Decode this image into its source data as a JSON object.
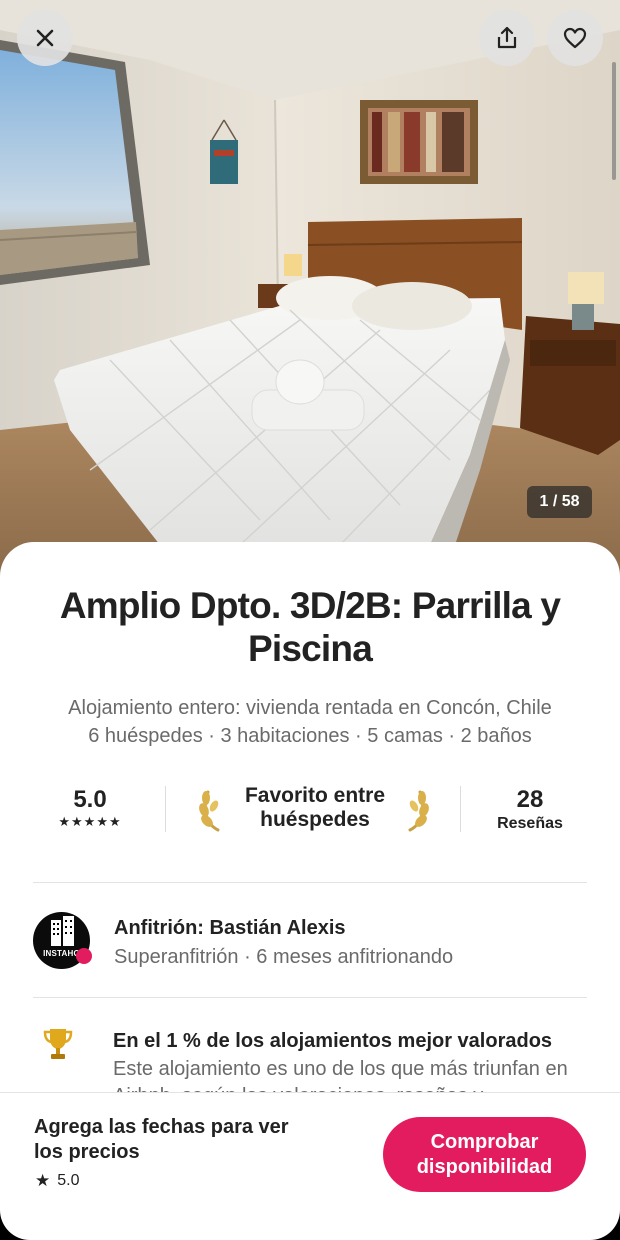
{
  "photo": {
    "counter": "1 / 58",
    "close_icon": "close-icon",
    "share_icon": "share-icon",
    "favorite_icon": "heart-icon"
  },
  "listing": {
    "title": "Amplio Dpto. 3D/2B: Parrilla y Piscina",
    "subtitle": "Alojamiento entero: vivienda rentada en Concón, Chile",
    "details": "6 huéspedes · 3 habitaciones · 5 camas · 2 baños"
  },
  "stats": {
    "rating": "5.0",
    "stars": "★★★★★",
    "guest_favorite": "Favorito entre huéspedes",
    "reviews_count": "28",
    "reviews_label": "Reseñas"
  },
  "host": {
    "avatar_text": "INSTAHO",
    "name": "Anfitrión: Bastián Alexis",
    "meta": "Superanfitrión · 6 meses anfitrionando"
  },
  "highlight": {
    "icon": "trophy-icon",
    "title": "En el 1 % de los alojamientos mejor valorados",
    "description": "Este alojamiento es uno de los que más triunfan en Airbnb, según las valoraciones, reseñas y"
  },
  "footer": {
    "prompt": "Agrega las fechas para ver los precios",
    "rating": "5.0",
    "cta": "Comprobar disponibilidad"
  },
  "colors": {
    "brand": "#e31c5f",
    "text": "#222222",
    "muted": "#6a6a6a"
  }
}
